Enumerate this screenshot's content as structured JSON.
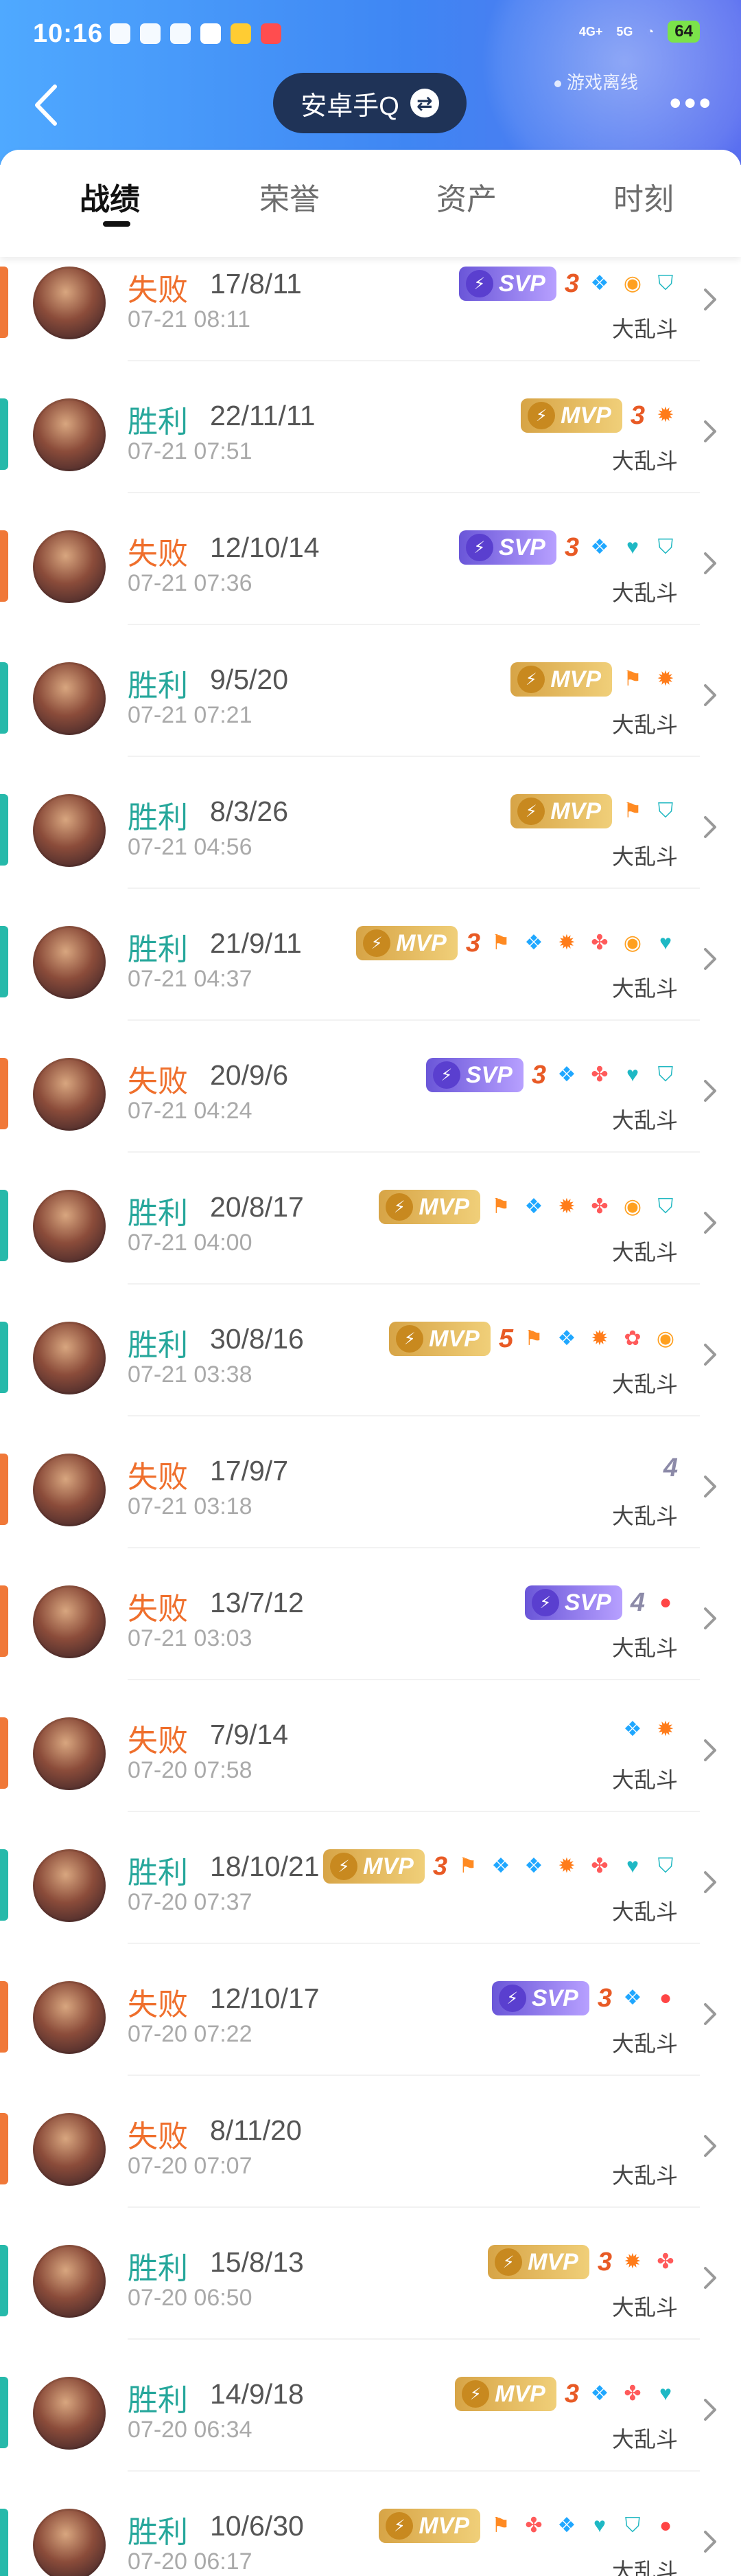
{
  "status_bar": {
    "time": "10:16",
    "net1": "4G+",
    "net2": "5G",
    "battery": "64",
    "offline_text": "游戏离线"
  },
  "header": {
    "title": "安卓手Q",
    "swap_icon": "swap-icon",
    "more_icon": "more-icon"
  },
  "tabs": [
    {
      "label": "战绩",
      "active": true
    },
    {
      "label": "荣誉",
      "active": false
    },
    {
      "label": "资产",
      "active": false
    },
    {
      "label": "时刻",
      "active": false
    }
  ],
  "matches": [
    {
      "result": "失败",
      "outcome": "lose",
      "kda": "17/8/11",
      "date": "07-21 08:11",
      "mode": "大乱斗",
      "badge": "SVP",
      "count": "3",
      "icons": [
        "blue-icon",
        "coin-icon",
        "shield-icon"
      ]
    },
    {
      "result": "胜利",
      "outcome": "win",
      "kda": "22/11/11",
      "date": "07-21 07:51",
      "mode": "大乱斗",
      "badge": "MVP",
      "count": "3",
      "icons": [
        "fire-icon"
      ]
    },
    {
      "result": "失败",
      "outcome": "lose",
      "kda": "12/10/14",
      "date": "07-21 07:36",
      "mode": "大乱斗",
      "badge": "SVP",
      "count": "3",
      "icons": [
        "blue-icon",
        "heart-icon",
        "shield-icon"
      ]
    },
    {
      "result": "胜利",
      "outcome": "win",
      "kda": "9/5/20",
      "date": "07-21 07:21",
      "mode": "大乱斗",
      "badge": "MVP",
      "count": "",
      "icons": [
        "flag-icon",
        "fire-icon"
      ]
    },
    {
      "result": "胜利",
      "outcome": "win",
      "kda": "8/3/26",
      "date": "07-21 04:56",
      "mode": "大乱斗",
      "badge": "MVP",
      "count": "",
      "icons": [
        "flag-icon",
        "shield-icon"
      ]
    },
    {
      "result": "胜利",
      "outcome": "win",
      "kda": "21/9/11",
      "date": "07-21 04:37",
      "mode": "大乱斗",
      "badge": "MVP",
      "count": "3",
      "icons": [
        "flag-icon",
        "blue-icon",
        "fire-icon",
        "skull-icon",
        "coin-icon",
        "heart-icon"
      ]
    },
    {
      "result": "失败",
      "outcome": "lose",
      "kda": "20/9/6",
      "date": "07-21 04:24",
      "mode": "大乱斗",
      "badge": "SVP",
      "count": "3",
      "icons": [
        "blue-icon",
        "skull-icon",
        "heart-icon",
        "shield-icon"
      ]
    },
    {
      "result": "胜利",
      "outcome": "win",
      "kda": "20/8/17",
      "date": "07-21 04:00",
      "mode": "大乱斗",
      "badge": "MVP",
      "count": "",
      "icons": [
        "flag-icon",
        "blue-icon",
        "fire-icon",
        "skull-icon",
        "coin-icon",
        "shield-icon"
      ]
    },
    {
      "result": "胜利",
      "outcome": "win",
      "kda": "30/8/16",
      "date": "07-21 03:38",
      "mode": "大乱斗",
      "badge": "MVP",
      "count": "5",
      "icons": [
        "flag-icon",
        "blue-icon",
        "fire-icon",
        "lotus-icon",
        "coin-icon"
      ]
    },
    {
      "result": "失败",
      "outcome": "lose",
      "kda": "17/9/7",
      "date": "07-21 03:18",
      "mode": "大乱斗",
      "badge": "",
      "count": "4",
      "count_grey": true,
      "icons": []
    },
    {
      "result": "失败",
      "outcome": "lose",
      "kda": "13/7/12",
      "date": "07-21 03:03",
      "mode": "大乱斗",
      "badge": "SVP",
      "count": "4",
      "count_grey": true,
      "icons": [
        "drop-icon"
      ]
    },
    {
      "result": "失败",
      "outcome": "lose",
      "kda": "7/9/14",
      "date": "07-20 07:58",
      "mode": "大乱斗",
      "badge": "",
      "count": "",
      "icons": [
        "blue-icon",
        "fire-icon"
      ]
    },
    {
      "result": "胜利",
      "outcome": "win",
      "kda": "18/10/21",
      "date": "07-20 07:37",
      "mode": "大乱斗",
      "badge": "MVP",
      "count": "3",
      "icons": [
        "flag-icon",
        "blue-icon",
        "blue-icon",
        "fire-icon",
        "skull-icon",
        "heart-icon",
        "shield-icon"
      ]
    },
    {
      "result": "失败",
      "outcome": "lose",
      "kda": "12/10/17",
      "date": "07-20 07:22",
      "mode": "大乱斗",
      "badge": "SVP",
      "count": "3",
      "icons": [
        "blue-icon",
        "drop-icon"
      ]
    },
    {
      "result": "失败",
      "outcome": "lose",
      "kda": "8/11/20",
      "date": "07-20 07:07",
      "mode": "大乱斗",
      "badge": "",
      "count": "",
      "icons": []
    },
    {
      "result": "胜利",
      "outcome": "win",
      "kda": "15/8/13",
      "date": "07-20 06:50",
      "mode": "大乱斗",
      "badge": "MVP",
      "count": "3",
      "icons": [
        "fire-icon",
        "skull-icon"
      ]
    },
    {
      "result": "胜利",
      "outcome": "win",
      "kda": "14/9/18",
      "date": "07-20 06:34",
      "mode": "大乱斗",
      "badge": "MVP",
      "count": "3",
      "icons": [
        "blue-icon",
        "skull-icon",
        "heart-icon"
      ]
    },
    {
      "result": "胜利",
      "outcome": "win",
      "kda": "10/6/30",
      "date": "07-20 06:17",
      "mode": "大乱斗",
      "badge": "MVP",
      "count": "",
      "icons": [
        "flag-icon",
        "skull-icon",
        "blue-icon",
        "heart-icon",
        "shield-icon",
        "drop-icon"
      ]
    }
  ],
  "colors": {
    "win": "#26b9aa",
    "lose": "#f07838",
    "mvp": "#d7a446",
    "svp": "#6a56d8",
    "header_blue": "#3f86f3"
  }
}
